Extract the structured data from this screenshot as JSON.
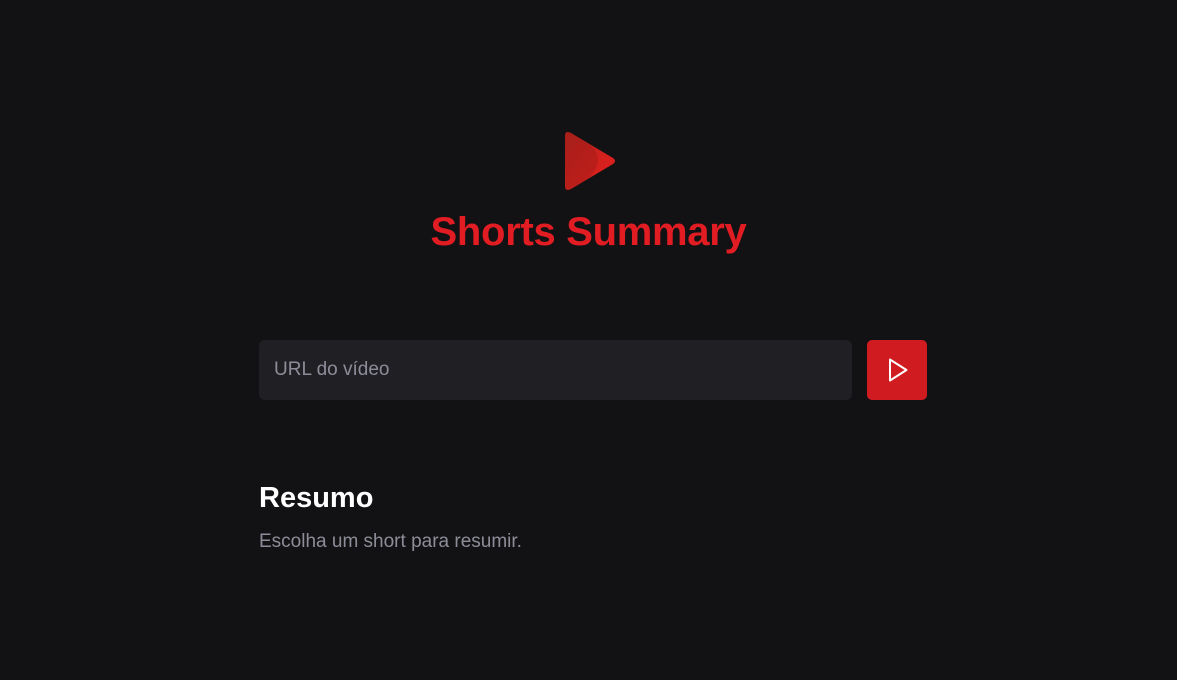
{
  "header": {
    "logo_icon": "play-triangle-icon",
    "title": "Shorts Summary"
  },
  "form": {
    "url_placeholder": "URL do vídeo",
    "url_value": "",
    "submit_icon": "play-icon"
  },
  "summary": {
    "heading": "Resumo",
    "text": "Escolha um short para resumir."
  },
  "colors": {
    "background": "#121214",
    "accent": "#e11d23",
    "button": "#d01c21",
    "input_background": "#202024",
    "muted_text": "#8d8d99",
    "heading_text": "#ffffff"
  }
}
